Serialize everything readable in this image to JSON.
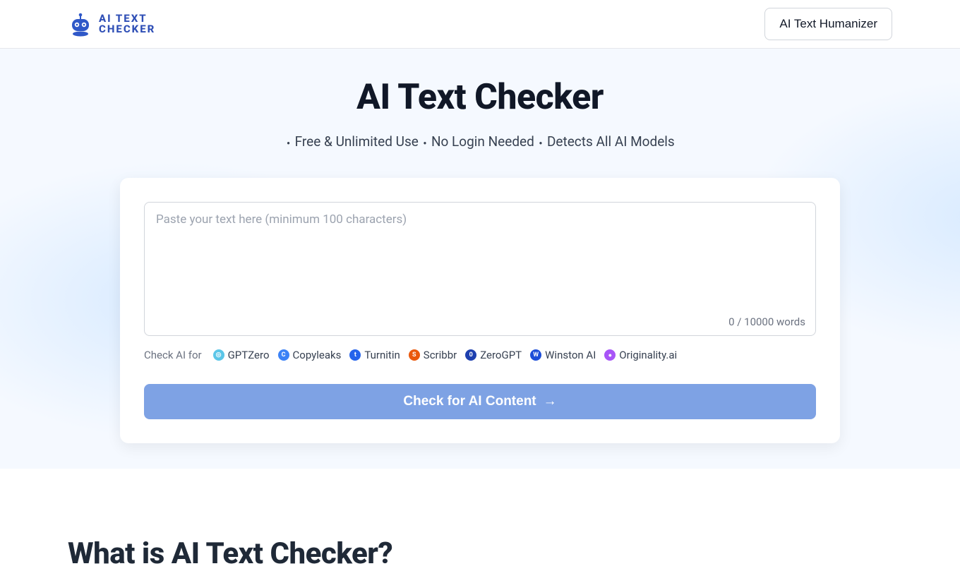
{
  "header": {
    "logo_top": "AI TEXT",
    "logo_bottom": "CHECKER",
    "humanizer_label": "AI Text Humanizer"
  },
  "hero": {
    "title": "AI Text Checker",
    "features": [
      "Free & Unlimited Use",
      "No Login Needed",
      "Detects All AI Models"
    ]
  },
  "input": {
    "placeholder": "Paste your text here (minimum 100 characters)",
    "value": "",
    "count_current": "0",
    "count_sep": " / ",
    "count_max": "10000",
    "count_unit": " words"
  },
  "detectors": {
    "label": "Check AI for",
    "items": [
      {
        "name": "GPTZero",
        "icon": "gptzero-icon",
        "bg": "#5bc6e8",
        "glyph": "◎"
      },
      {
        "name": "Copyleaks",
        "icon": "copyleaks-icon",
        "bg": "#3b82f6",
        "glyph": "C"
      },
      {
        "name": "Turnitin",
        "icon": "turnitin-icon",
        "bg": "#2563eb",
        "glyph": "t"
      },
      {
        "name": "Scribbr",
        "icon": "scribbr-icon",
        "bg": "#ea580c",
        "glyph": "S"
      },
      {
        "name": "ZeroGPT",
        "icon": "zerogpt-icon",
        "bg": "#1e40af",
        "glyph": "0"
      },
      {
        "name": "Winston AI",
        "icon": "winston-icon",
        "bg": "#1d4ed8",
        "glyph": "W"
      },
      {
        "name": "Originality.ai",
        "icon": "originality-icon",
        "bg": "#a855f7",
        "glyph": "●"
      }
    ]
  },
  "cta": {
    "label": "Check for AI Content",
    "arrow": "→"
  },
  "section": {
    "heading": "What is AI Text Checker?"
  }
}
